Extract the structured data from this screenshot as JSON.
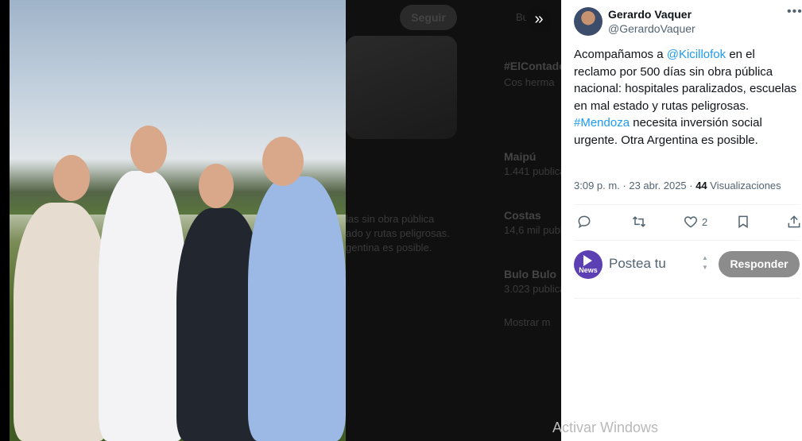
{
  "background_page": {
    "follow_label": "Seguir",
    "search_label": "Bu",
    "trend_items": [
      {
        "title": "#ElContado",
        "sub": "Cos herma"
      },
      {
        "title": "Maipú",
        "sub": "1.441 publica"
      },
      {
        "title": "Costas",
        "sub": "14,6 mil publ"
      },
      {
        "title": "Bulo Bulo",
        "sub": "3.023 publica"
      }
    ],
    "tweet_snippet": [
      "las sin obra pública",
      "ado y rutas peligrosas.",
      "gentina es posible."
    ],
    "show_more": "Mostrar m"
  },
  "tweet": {
    "author_name": "Gerardo Vaquer",
    "author_handle": "@GerardoVaquer",
    "text_parts": [
      {
        "text": "Acompañamos a ",
        "link": false
      },
      {
        "text": "@Kicillofok",
        "link": true
      },
      {
        "text": " en el reclamo por 500 días sin obra pública nacional: hospitales paralizados, escuelas en mal estado y rutas peligrosas. ",
        "link": false
      },
      {
        "text": "#Mendoza",
        "link": true
      },
      {
        "text": " necesita inversión social urgente. Otra Argentina es posible.",
        "link": false
      }
    ],
    "timestamp": "3:09 p. m. · 23 abr. 2025 · ",
    "views_count": "44",
    "views_label": " Visualizaciones",
    "likes_count": "2"
  },
  "reply": {
    "placeholder": "Postea tu",
    "button_label": "Responder",
    "avatar_text": "News"
  },
  "watermark": "Activar Windows",
  "colors": {
    "link": "#1d9bf0",
    "muted": "#536471",
    "reply_button": "#8c8c8c",
    "news_avatar": "#5b3fb3"
  }
}
